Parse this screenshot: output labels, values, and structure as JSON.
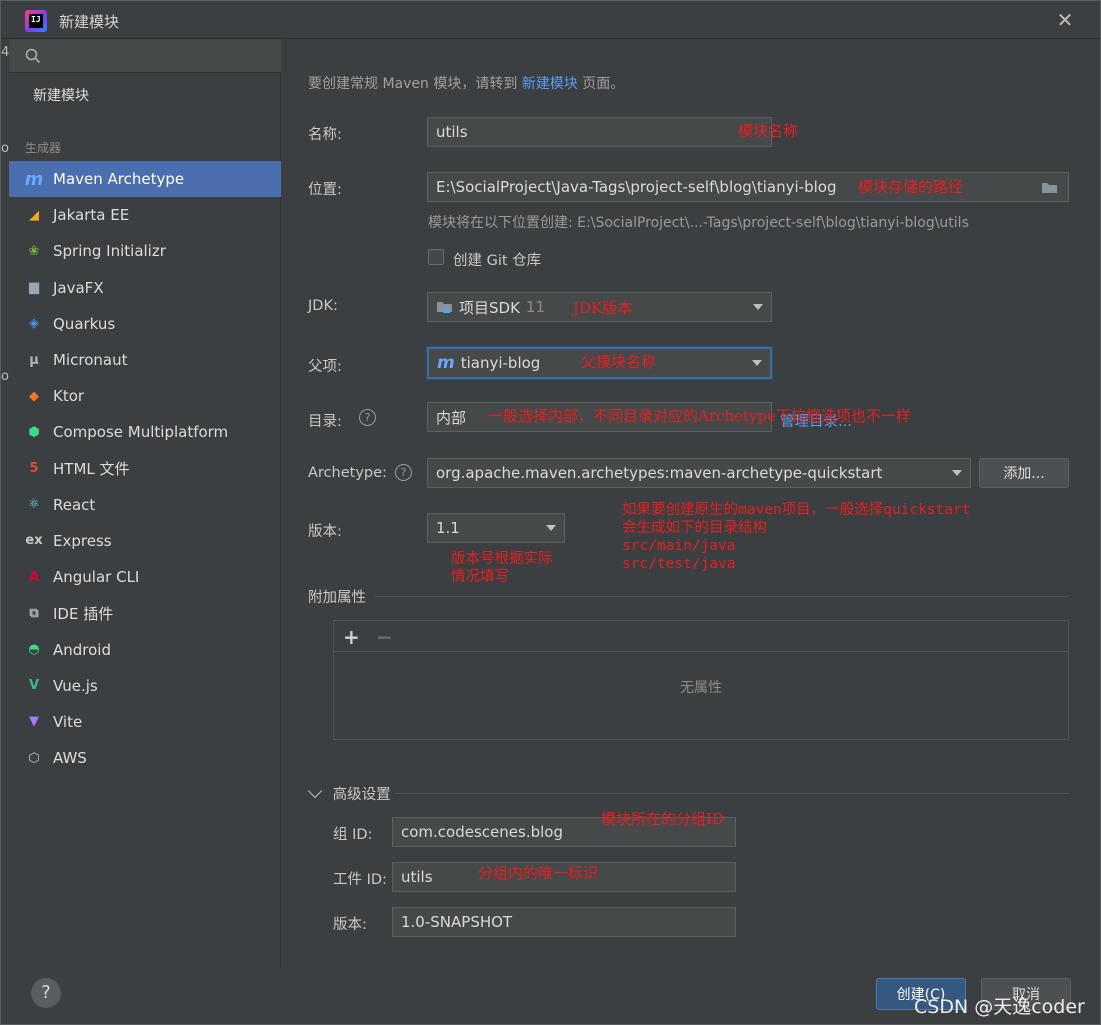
{
  "window": {
    "title": "新建模块",
    "close_glyph": "✕"
  },
  "sidebar": {
    "search_placeholder": "",
    "new_module": "新建模块",
    "generators_label": "生成器",
    "items": [
      {
        "label": "Maven Archetype",
        "icon": "maven-icon",
        "glyph": "m",
        "color": "#6aa7ff"
      },
      {
        "label": "Jakarta EE",
        "icon": "jakarta-ee-icon",
        "glyph": "◢",
        "color": "#f7a51c"
      },
      {
        "label": "Spring Initializr",
        "icon": "spring-icon",
        "glyph": "❀",
        "color": "#6db33f"
      },
      {
        "label": "JavaFX",
        "icon": "folder-icon",
        "glyph": "▆",
        "color": "#9aa7b0"
      },
      {
        "label": "Quarkus",
        "icon": "quarkus-icon",
        "glyph": "◈",
        "color": "#4695eb"
      },
      {
        "label": "Micronaut",
        "icon": "micronaut-icon",
        "glyph": "μ",
        "color": "#b4b4b4"
      },
      {
        "label": "Ktor",
        "icon": "ktor-icon",
        "glyph": "◆",
        "color": "#ff6f28"
      },
      {
        "label": "Compose Multiplatform",
        "icon": "compose-icon",
        "glyph": "⬢",
        "color": "#3ddc84"
      },
      {
        "label": "HTML 文件",
        "icon": "html5-icon",
        "glyph": "5",
        "color": "#e44d26"
      },
      {
        "label": "React",
        "icon": "react-icon",
        "glyph": "⚛",
        "color": "#61dafb"
      },
      {
        "label": "Express",
        "icon": "express-icon",
        "glyph": "ex",
        "color": "#c8c8c8"
      },
      {
        "label": "Angular CLI",
        "icon": "angular-icon",
        "glyph": "A",
        "color": "#dd0031"
      },
      {
        "label": "IDE 插件",
        "icon": "plugin-icon",
        "glyph": "⧉",
        "color": "#b4b4b4"
      },
      {
        "label": "Android",
        "icon": "android-icon",
        "glyph": "◓",
        "color": "#3ddc84"
      },
      {
        "label": "Vue.js",
        "icon": "vue-icon",
        "glyph": "V",
        "color": "#41b883"
      },
      {
        "label": "Vite",
        "icon": "vite-icon",
        "glyph": "▼",
        "color": "#a67cff"
      },
      {
        "label": "AWS",
        "icon": "aws-cube-icon",
        "glyph": "⬡",
        "color": "#c8c8c8"
      }
    ]
  },
  "main": {
    "hint_prefix": "要创建常规 Maven 模块，请转到",
    "hint_link": "新建模块",
    "hint_suffix": "页面。",
    "name": {
      "label": "名称:",
      "value": "utils",
      "note": "模块名称"
    },
    "location": {
      "label": "位置:",
      "value": "E:\\SocialProject\\Java-Tags\\project-self\\blog\\tianyi-blog",
      "note": "模块存储的路径",
      "created_hint": "模块将在以下位置创建: E:\\SocialProject\\...-Tags\\project-self\\blog\\tianyi-blog\\utils"
    },
    "git": {
      "label": "创建 Git 仓库",
      "checked": false
    },
    "jdk": {
      "label": "JDK:",
      "value": "项目SDK",
      "version": "11",
      "note": "JDK版本"
    },
    "parent": {
      "label": "父项:",
      "value": "tianyi-blog",
      "note": "父模块名称"
    },
    "catalog": {
      "label": "目录:",
      "value": "内部",
      "manage_link": "管理目录...",
      "note": "一般选择内部，不同目录对应的Archetype下拉框选项也不一样"
    },
    "archetype": {
      "label": "Archetype:",
      "value": "org.apache.maven.archetypes:maven-archetype-quickstart",
      "add_button": "添加...",
      "note_lines": [
        "如果要创建原生的maven项目，一般选择quickstart",
        "会生成如下的目录结构",
        "src/main/java",
        "src/test/java"
      ]
    },
    "version": {
      "label": "版本:",
      "value": "1.1",
      "note_lines": [
        "版本号根据实际",
        "情况填写"
      ]
    },
    "extra_props": {
      "label": "附加属性",
      "add": "+",
      "remove": "−",
      "empty": "无属性"
    },
    "advanced": {
      "label": "高级设置",
      "group_id": {
        "label": "组 ID:",
        "value": "com.codescenes.blog",
        "note": "模块所在的分组ID"
      },
      "artifact_id": {
        "label": "工件 ID:",
        "value": "utils",
        "note": "分组内的唯一标识"
      },
      "version": {
        "label": "版本:",
        "value": "1.0-SNAPSHOT"
      }
    }
  },
  "footer": {
    "help": "?",
    "create": "创建(C)",
    "cancel": "取消",
    "watermark": "CSDN @天逸coder"
  }
}
